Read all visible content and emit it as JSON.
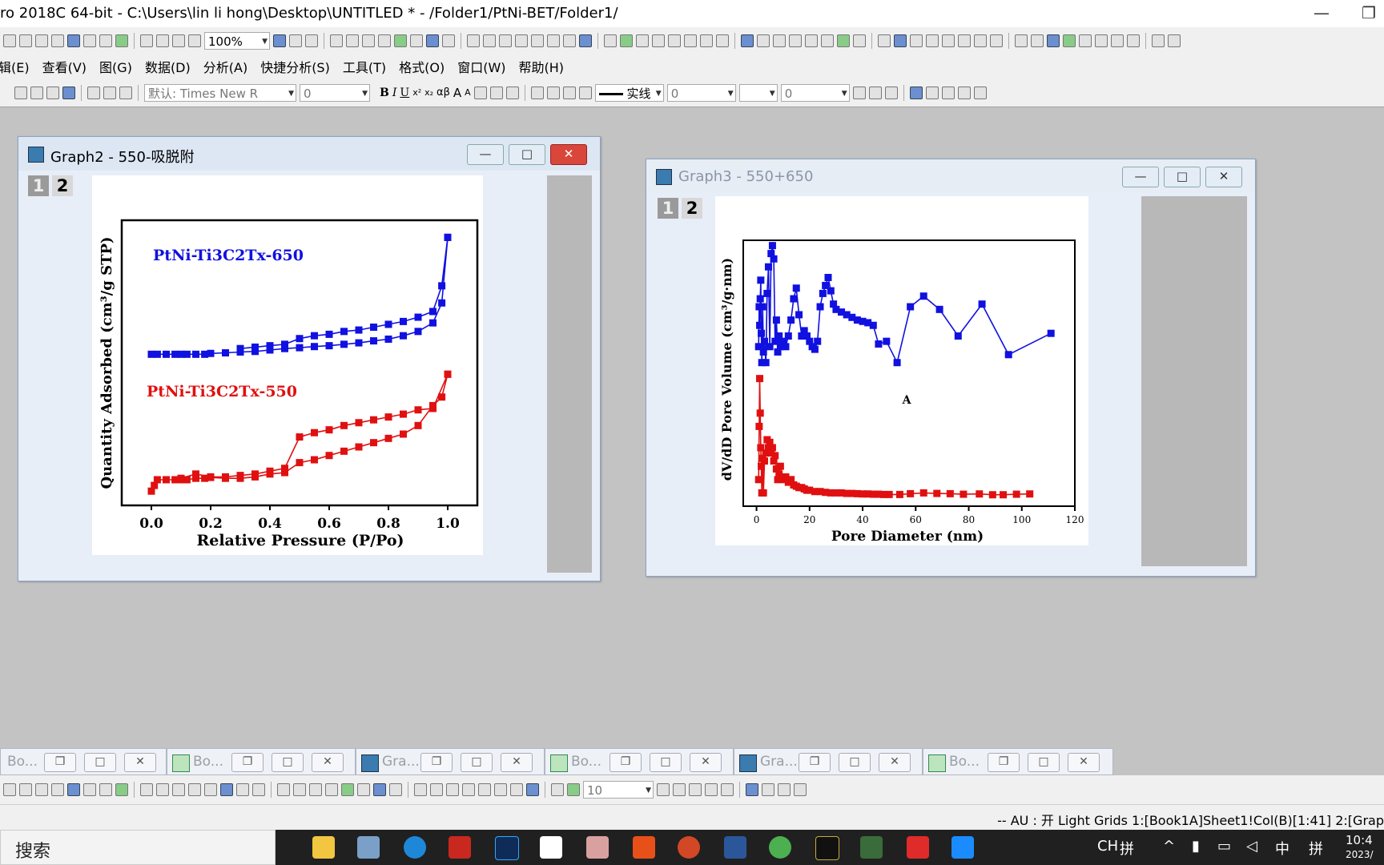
{
  "app": {
    "title": "ro 2018C 64-bit - C:\\Users\\lin li hong\\Desktop\\UNTITLED * - /Folder1/PtNi-BET/Folder1/",
    "minimize": "—",
    "restore": "❐"
  },
  "toolbar1": {
    "zoom": "100%"
  },
  "menu": [
    "编辑(E)",
    "查看(V)",
    "图(G)",
    "数据(D)",
    "分析(A)",
    "快捷分析(S)",
    "工具(T)",
    "格式(O)",
    "窗口(W)",
    "帮助(H)"
  ],
  "menu_first_visible": "辑(E)",
  "toolbar2": {
    "font": "默认: Times New R",
    "font_size": "0",
    "bold": "B",
    "italic": "I",
    "underline": "U",
    "sup": "x²",
    "sub": "x₂",
    "greek": "αβ",
    "grow": "A",
    "shrink": "A",
    "line_style": "实线",
    "line_width": "0",
    "pattern_value": "0"
  },
  "graph2": {
    "title": "Graph2 - 550-吸脱附",
    "layer1": "1",
    "layer2": "2",
    "chart_data": {
      "type": "scatter",
      "xlabel": "Relative Pressure (P/Po)",
      "ylabel": "Quantity Adsorbed (cm³/g STP)",
      "xlim": [
        -0.1,
        1.1
      ],
      "ylim": [
        0,
        100
      ],
      "xticks": [
        "0.0",
        "0.2",
        "0.4",
        "0.6",
        "0.8",
        "1.0"
      ],
      "xtick_values": [
        0,
        0.2,
        0.4,
        0.6,
        0.8,
        1.0
      ],
      "series": [
        {
          "name": "PtNi-Ti3C2Tx-650",
          "color": "#1010e0",
          "branches": [
            [
              [
                0,
                53
              ],
              [
                0.02,
                53
              ],
              [
                0.05,
                53
              ],
              [
                0.08,
                53
              ],
              [
                0.1,
                53
              ],
              [
                0.12,
                53
              ],
              [
                0.15,
                53
              ],
              [
                0.18,
                53
              ],
              [
                0.2,
                53.3
              ],
              [
                0.25,
                53.5
              ],
              [
                0.3,
                53.8
              ],
              [
                0.35,
                54
              ],
              [
                0.4,
                54.5
              ],
              [
                0.45,
                55
              ],
              [
                0.5,
                55.3
              ],
              [
                0.55,
                55.7
              ],
              [
                0.6,
                56
              ],
              [
                0.65,
                56.5
              ],
              [
                0.7,
                57
              ],
              [
                0.75,
                57.7
              ],
              [
                0.8,
                58.3
              ],
              [
                0.85,
                59.5
              ],
              [
                0.9,
                61
              ],
              [
                0.95,
                64
              ],
              [
                0.98,
                71
              ],
              [
                1.0,
                94
              ]
            ],
            [
              [
                1.0,
                94
              ],
              [
                0.98,
                77
              ],
              [
                0.95,
                68
              ],
              [
                0.9,
                66
              ],
              [
                0.85,
                64.5
              ],
              [
                0.8,
                63.5
              ],
              [
                0.75,
                62.5
              ],
              [
                0.7,
                61.5
              ],
              [
                0.65,
                61
              ],
              [
                0.6,
                60
              ],
              [
                0.55,
                59.5
              ],
              [
                0.5,
                58.5
              ],
              [
                0.45,
                56.5
              ],
              [
                0.4,
                56
              ],
              [
                0.35,
                55.5
              ],
              [
                0.3,
                55
              ]
            ]
          ]
        },
        {
          "name": "PtNi-Ti3C2Tx-550",
          "color": "#e01010",
          "branches": [
            [
              [
                0,
                5
              ],
              [
                0.01,
                7
              ],
              [
                0.02,
                9
              ],
              [
                0.05,
                9
              ],
              [
                0.08,
                9
              ],
              [
                0.1,
                9
              ],
              [
                0.12,
                9
              ],
              [
                0.15,
                9.5
              ],
              [
                0.18,
                9.5
              ],
              [
                0.2,
                9.8
              ],
              [
                0.25,
                9.5
              ],
              [
                0.3,
                9.5
              ],
              [
                0.35,
                10
              ],
              [
                0.4,
                11
              ],
              [
                0.45,
                11.5
              ],
              [
                0.5,
                15
              ],
              [
                0.55,
                16
              ],
              [
                0.6,
                17.5
              ],
              [
                0.65,
                19
              ],
              [
                0.7,
                20.5
              ],
              [
                0.75,
                22
              ],
              [
                0.8,
                23.5
              ],
              [
                0.85,
                25
              ],
              [
                0.9,
                28
              ],
              [
                0.95,
                35
              ],
              [
                0.98,
                38
              ],
              [
                1.0,
                46
              ]
            ],
            [
              [
                1.0,
                46
              ],
              [
                0.95,
                34
              ],
              [
                0.9,
                33.5
              ],
              [
                0.85,
                32
              ],
              [
                0.8,
                31
              ],
              [
                0.75,
                30
              ],
              [
                0.7,
                29
              ],
              [
                0.65,
                28
              ],
              [
                0.6,
                26.5
              ],
              [
                0.55,
                25.5
              ],
              [
                0.5,
                24
              ],
              [
                0.45,
                13
              ],
              [
                0.4,
                12
              ],
              [
                0.35,
                11
              ],
              [
                0.3,
                10.5
              ],
              [
                0.25,
                10
              ],
              [
                0.2,
                10
              ],
              [
                0.15,
                11
              ],
              [
                0.1,
                9.5
              ]
            ]
          ]
        }
      ]
    }
  },
  "graph3": {
    "title": "Graph3 - 550+650",
    "layer1": "1",
    "layer2": "2",
    "annotation": "A",
    "chart_data": {
      "type": "line",
      "xlabel": "Pore Diameter (nm)",
      "ylabel": "dV/dD Pore Volume (cm³/g·nm)",
      "xlim": [
        -5,
        120
      ],
      "ylim": [
        0,
        100
      ],
      "xticks": [
        "0",
        "20",
        "40",
        "60",
        "80",
        "100",
        "120"
      ],
      "xtick_values": [
        0,
        20,
        40,
        60,
        80,
        100,
        120
      ],
      "series": [
        {
          "color": "#1010e0",
          "points": [
            [
              0.8,
              60
            ],
            [
              1,
              75
            ],
            [
              1.2,
              68
            ],
            [
              1.4,
              78
            ],
            [
              1.6,
              85
            ],
            [
              1.8,
              65
            ],
            [
              2,
              54
            ],
            [
              2.3,
              75
            ],
            [
              2.6,
              58
            ],
            [
              3,
              62
            ],
            [
              3.5,
              54
            ],
            [
              4,
              80
            ],
            [
              4.5,
              90
            ],
            [
              5,
              60
            ],
            [
              5.5,
              95
            ],
            [
              6,
              98
            ],
            [
              6.5,
              93
            ],
            [
              7,
              62
            ],
            [
              7.5,
              70
            ],
            [
              8,
              58
            ],
            [
              8.5,
              64
            ],
            [
              9,
              60
            ],
            [
              10,
              62
            ],
            [
              11,
              60
            ],
            [
              12,
              64
            ],
            [
              13,
              70
            ],
            [
              14,
              78
            ],
            [
              15,
              82
            ],
            [
              16,
              72
            ],
            [
              17,
              64
            ],
            [
              18,
              66
            ],
            [
              19,
              64
            ],
            [
              20,
              62
            ],
            [
              21,
              60
            ],
            [
              22,
              59
            ],
            [
              23,
              62
            ],
            [
              24,
              75
            ],
            [
              25,
              80
            ],
            [
              26,
              83
            ],
            [
              27,
              86
            ],
            [
              28,
              81
            ],
            [
              29,
              76
            ],
            [
              30,
              74
            ],
            [
              32,
              73
            ],
            [
              34,
              72
            ],
            [
              36,
              71
            ],
            [
              38,
              70
            ],
            [
              40,
              69.5
            ],
            [
              42,
              69
            ],
            [
              44,
              68
            ],
            [
              46,
              61
            ],
            [
              49,
              62
            ],
            [
              53,
              54
            ],
            [
              58,
              75
            ],
            [
              63,
              79
            ],
            [
              69,
              74
            ],
            [
              76,
              64
            ],
            [
              85,
              76
            ],
            [
              95,
              57
            ],
            [
              111,
              65
            ]
          ]
        },
        {
          "color": "#e01010",
          "points": [
            [
              0.8,
              10
            ],
            [
              1,
              30
            ],
            [
              1.2,
              48
            ],
            [
              1.4,
              35
            ],
            [
              1.6,
              22
            ],
            [
              1.8,
              15
            ],
            [
              2,
              5
            ],
            [
              2.3,
              18
            ],
            [
              2.6,
              5
            ],
            [
              3,
              17
            ],
            [
              3.5,
              20
            ],
            [
              4,
              25
            ],
            [
              4.5,
              22
            ],
            [
              5,
              24
            ],
            [
              5.5,
              20
            ],
            [
              6,
              22
            ],
            [
              6.5,
              17
            ],
            [
              7,
              19
            ],
            [
              7.5,
              14
            ],
            [
              8,
              10
            ],
            [
              8.5,
              12
            ],
            [
              9,
              15
            ],
            [
              10,
              10
            ],
            [
              11,
              11
            ],
            [
              12,
              9
            ],
            [
              13,
              10
            ],
            [
              14,
              8
            ],
            [
              15,
              7.5
            ],
            [
              16,
              7
            ],
            [
              17,
              7
            ],
            [
              18,
              6.5
            ],
            [
              19,
              6
            ],
            [
              20,
              6
            ],
            [
              22,
              5.5
            ],
            [
              24,
              5.5
            ],
            [
              26,
              5.2
            ],
            [
              28,
              5
            ],
            [
              30,
              5
            ],
            [
              32,
              5
            ],
            [
              34,
              4.8
            ],
            [
              36,
              4.8
            ],
            [
              38,
              4.7
            ],
            [
              40,
              4.6
            ],
            [
              42,
              4.6
            ],
            [
              44,
              4.5
            ],
            [
              46,
              4.5
            ],
            [
              48,
              4.4
            ],
            [
              50,
              4.4
            ],
            [
              54,
              4.4
            ],
            [
              58,
              4.7
            ],
            [
              63,
              5
            ],
            [
              68,
              4.8
            ],
            [
              73,
              4.7
            ],
            [
              78,
              4.5
            ],
            [
              84,
              4.6
            ],
            [
              89,
              4.3
            ],
            [
              93,
              4.3
            ],
            [
              98,
              4.5
            ],
            [
              103,
              4.6
            ]
          ]
        }
      ]
    }
  },
  "minimized": [
    {
      "label": "Bo..."
    },
    {
      "label": "Bo..."
    },
    {
      "label": "Gra..."
    },
    {
      "label": "Bo..."
    },
    {
      "label": "Gra..."
    },
    {
      "label": "Bo..."
    }
  ],
  "toolbar3": {
    "size": "10"
  },
  "status": {
    "text": "--    AU : 开 Light Grids 1:[Book1A]Sheet1!Col(B)[1:41] 2:[Grap"
  },
  "taskbar": {
    "search": "搜索",
    "tray_lang": "CH",
    "tray_ime": "拼",
    "tray_ime2": "中",
    "tray_ime3": "拼",
    "time": "10:4",
    "date": "2023/"
  }
}
